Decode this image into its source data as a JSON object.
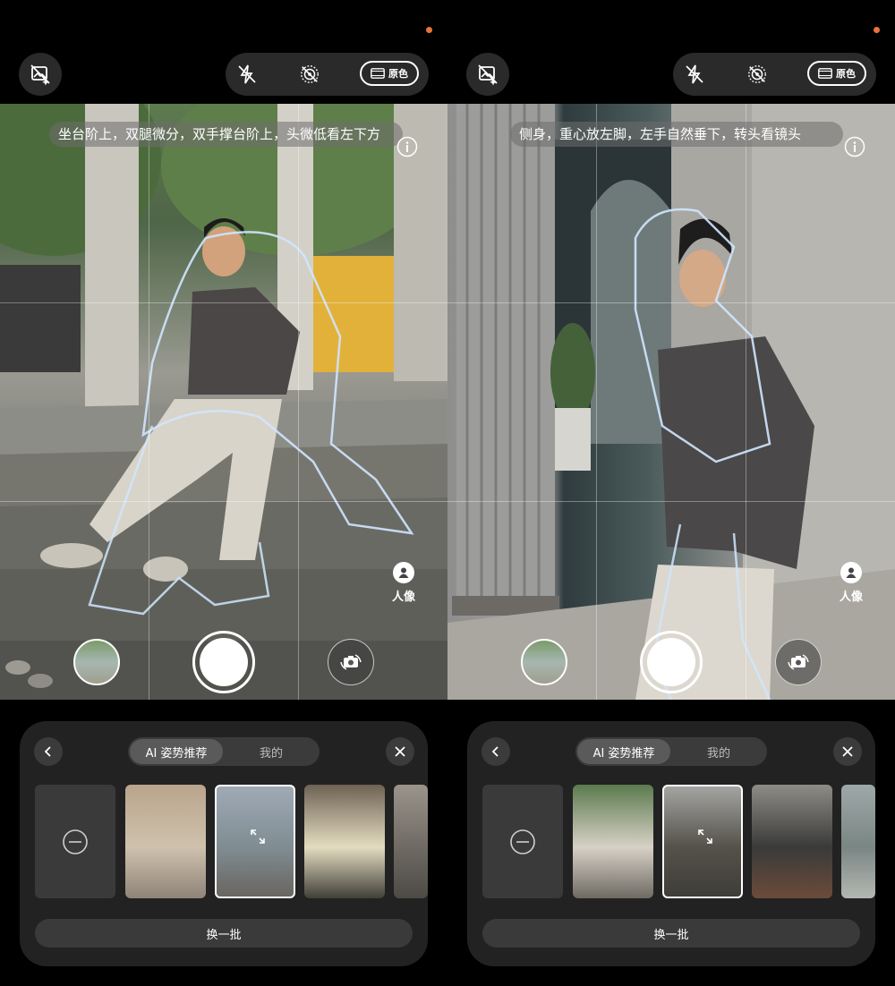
{
  "screens": [
    {
      "id": "left",
      "top_bar": {
        "filter_label": "原色"
      },
      "hint_text": "坐台阶上，双腿微分，双手撑台阶上，头微低看左下方",
      "portrait_label": "人像",
      "panel": {
        "tabs": [
          {
            "label": "AI 姿势推荐",
            "active": true
          },
          {
            "label": "我的",
            "active": false
          }
        ],
        "refresh_label": "换一批",
        "poses": [
          {
            "colors": [
              "#b9a58c",
              "#cfc1ad",
              "#8f8479"
            ],
            "selected": false
          },
          {
            "colors": [
              "#a0aab5",
              "#7f8d93",
              "#6a6560"
            ],
            "selected": true
          },
          {
            "colors": [
              "#6e6254",
              "#e4dcc0",
              "#414038"
            ],
            "selected": false
          },
          {
            "colors": [
              "#9b948c",
              "#6f6a64",
              "#4d4a45"
            ],
            "selected": false
          }
        ]
      }
    },
    {
      "id": "right",
      "top_bar": {
        "filter_label": "原色"
      },
      "hint_text": "侧身，重心放左脚，左手自然垂下，转头看镜头",
      "portrait_label": "人像",
      "panel": {
        "tabs": [
          {
            "label": "AI 姿势推荐",
            "active": true
          },
          {
            "label": "我的",
            "active": false
          }
        ],
        "refresh_label": "换一批",
        "poses": [
          {
            "colors": [
              "#5b7a4d",
              "#d7d1c6",
              "#6e6a63"
            ],
            "selected": false
          },
          {
            "colors": [
              "#a4a4a2",
              "#55524a",
              "#3f3d38"
            ],
            "selected": true
          },
          {
            "colors": [
              "#8e8c86",
              "#3a3a3a",
              "#6b4b3a"
            ],
            "selected": false
          },
          {
            "colors": [
              "#9ea8a8",
              "#7a8684",
              "#b3b7b2"
            ],
            "selected": false
          }
        ]
      }
    }
  ],
  "colors": {
    "status_dot": "#e8743b",
    "panel_bg": "#222222",
    "pill_bg": "#2a2a2a"
  }
}
